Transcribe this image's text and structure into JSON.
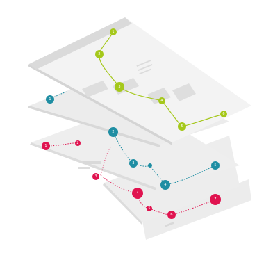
{
  "colors": {
    "layer_light": "#f2f2f2",
    "layer_mid": "#e9e9e9",
    "layer_dark": "#dcdcdc",
    "block": "#d6d6d6",
    "green": "#a5c81b",
    "teal": "#1f8ea3",
    "pink": "#e0134f"
  },
  "icons": {
    "green_path": "green-user-flow-path",
    "teal_path": "teal-user-flow-path",
    "pink_path": "pink-user-flow-path"
  },
  "flows": {
    "green": {
      "steps": [
        "1",
        "2",
        "3",
        "4",
        "5",
        "6"
      ]
    },
    "teal": {
      "steps": [
        "1",
        "2",
        "3",
        "4",
        "5"
      ]
    },
    "pink": {
      "steps": [
        "1",
        "2",
        "3",
        "4",
        "5",
        "6",
        "7"
      ]
    }
  }
}
